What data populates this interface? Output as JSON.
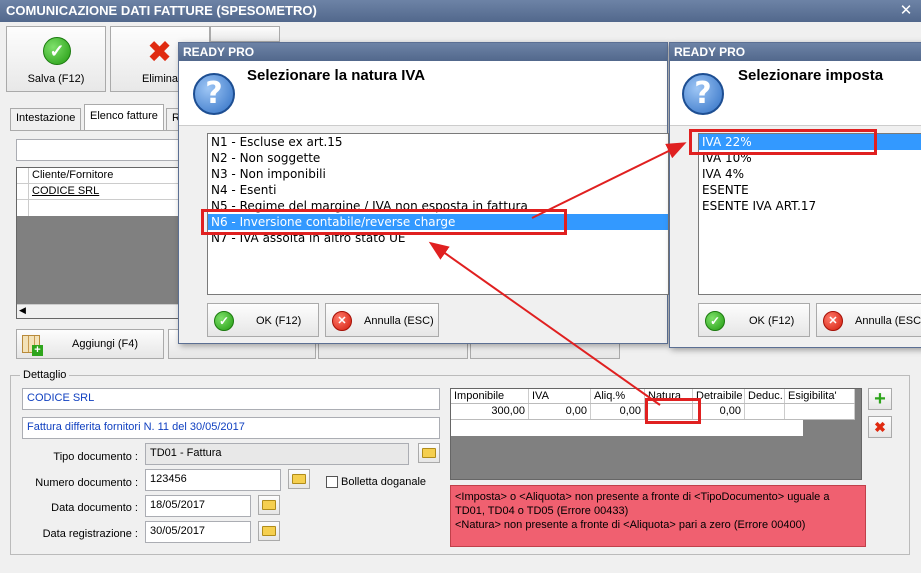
{
  "window": {
    "title": "COMUNICAZIONE DATI FATTURE (SPESOMETRO)",
    "close": "✕"
  },
  "toolbar": {
    "save_label": "Salva (F12)",
    "delete_label": "Elimina"
  },
  "tabs": [
    {
      "label": "Intestazione"
    },
    {
      "label": "Elenco fatture"
    },
    {
      "label": "R"
    }
  ],
  "clients_grid": {
    "header": "Cliente/Fornitore",
    "rows": [
      "CODICE SRL"
    ]
  },
  "actions": {
    "add_label": "Aggiungi (F4)"
  },
  "detail": {
    "group_label": "Dettaglio",
    "name": "CODICE SRL",
    "description": "Fattura differita fornitori N. 11 del 30/05/2017",
    "doc_type_label": "Tipo documento :",
    "doc_type": "TD01 - Fattura",
    "doc_number_label": "Numero documento :",
    "doc_number": "123456",
    "bolletta_label": "Bolletta doganale",
    "doc_date_label": "Data documento :",
    "doc_date": "18/05/2017",
    "reg_date_label": "Data registrazione :",
    "reg_date": "30/05/2017"
  },
  "vat_grid": {
    "headers": [
      "Imponibile",
      "IVA",
      "Aliq.%",
      "Natura",
      "Detraibile",
      "Deduc.",
      "Esigibilita'"
    ],
    "row": [
      "300,00",
      "0,00",
      "0,00",
      "",
      "0,00",
      "",
      ""
    ]
  },
  "errors": "<Imposta> o <Aliquota> non presente a fronte di <TipoDocumento> uguale a TD01, TD04 o TD05 (Errore 00433)\n<Natura> non presente a fronte di <Aliquota> pari a zero (Errore 00400)",
  "dialog_natura": {
    "title": "READY PRO",
    "heading": "Selezionare la natura IVA",
    "items": [
      "N1 - Escluse ex art.15",
      "N2 - Non soggette",
      "N3 - Non imponibili",
      "N4 - Esenti",
      "N5 - Regime del margine / IVA non esposta in fattura",
      "N6 - Inversione contabile/reverse charge",
      "N7 - IVA assolta in altro stato UE"
    ],
    "selected_index": 5,
    "ok_label": "OK (F12)",
    "cancel_label": "Annulla (ESC)"
  },
  "dialog_imposta": {
    "title": "READY PRO",
    "heading": "Selezionare imposta",
    "items": [
      "IVA 22%",
      "IVA 10%",
      "IVA 4%",
      "ESENTE",
      "ESENTE IVA ART.17"
    ],
    "selected_index": 0,
    "ok_label": "OK (F12)",
    "cancel_label": "Annulla (ESC)"
  },
  "colors": {
    "selection": "#3399ff",
    "highlight": "#e02020",
    "error_bg": "#f06070",
    "titlebar": "#52688c"
  },
  "icons": [
    "check-icon",
    "delete-icon",
    "help-icon",
    "folder-icon",
    "add-icon"
  ]
}
